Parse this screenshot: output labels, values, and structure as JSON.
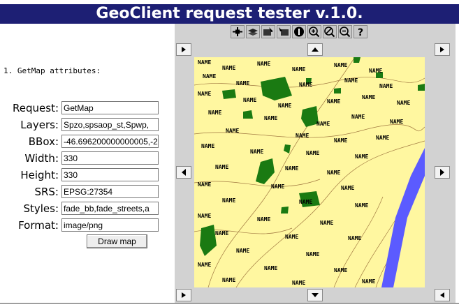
{
  "title": "GeoClient request tester v.1.0.",
  "section_title": "1. GetMap attributes:",
  "fields": [
    {
      "label": "Request:",
      "value": "GetMap"
    },
    {
      "label": "Layers:",
      "value": "Spzo,spsaop_st,Spwp,"
    },
    {
      "label": "BBox:",
      "value": "-46.696200000000005,-2"
    },
    {
      "label": "Width:",
      "value": "330"
    },
    {
      "label": "Height:",
      "value": "330"
    },
    {
      "label": "SRS:",
      "value": "EPSG:27354"
    },
    {
      "label": "Styles:",
      "value": "fade_bb,fade_streets,a"
    },
    {
      "label": "Format:",
      "value": "image/png"
    }
  ],
  "draw_button": "Draw map",
  "toolbar_icons": [
    "pan-icon",
    "layers-icon",
    "select-icon",
    "select-area-icon",
    "info-icon",
    "zoom-in-icon",
    "zoom-reset-icon",
    "zoom-out-icon",
    "help-icon"
  ],
  "map_label": "NAME",
  "colors": {
    "header_bg": "#1d1f74",
    "map_land": "#fff7a0",
    "map_park": "#1a7a12",
    "map_river": "#5b5bff",
    "panel_bg": "#d2d2d2"
  }
}
